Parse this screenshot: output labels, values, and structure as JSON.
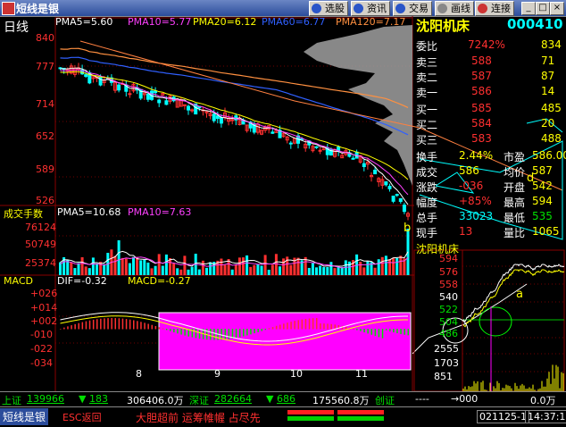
{
  "titlebar": {
    "title": "短线是银",
    "buttons": [
      "选股",
      "资讯",
      "交易",
      "画线",
      "连接"
    ]
  },
  "main_chart": {
    "period_label": "日线",
    "ma_labels": [
      "PMA5=5.60",
      "PMA10=5.77",
      "PMA20=6.12",
      "PMA60=6.77",
      "PMA120=7.17"
    ],
    "ma_colors": [
      "#ffffff",
      "#ff40ff",
      "#ffff00",
      "#3060ff",
      "#ff9040"
    ],
    "y_ticks": [
      "840",
      "777",
      "714",
      "652",
      "589",
      "526"
    ],
    "marker_b": "b",
    "marker_d": "d",
    "marker_a": "a"
  },
  "volume_chart": {
    "title": "成交手数",
    "ma_labels": [
      "PMA5=10.68",
      "PMA10=7.63"
    ],
    "y_ticks": [
      "76124",
      "50749",
      "25374"
    ]
  },
  "macd_chart": {
    "title": "MACD",
    "labels": [
      "DIF=-0.32",
      "MACD=-0.27"
    ],
    "y_ticks": [
      "+026",
      "+014",
      "+002",
      "-010",
      "-022",
      "-034"
    ],
    "x_ticks": [
      "8",
      "9",
      "10",
      "11"
    ]
  },
  "quote_panel": {
    "stock_name": "沈阳机床",
    "stock_code": "000410",
    "weibi_label": "委比",
    "weibi_value": "7242%",
    "weibi_vol": "834",
    "asks": [
      {
        "label": "卖三",
        "price": "588",
        "vol": "71"
      },
      {
        "label": "卖二",
        "price": "587",
        "vol": "87"
      },
      {
        "label": "卖一",
        "price": "586",
        "vol": "14"
      }
    ],
    "bids": [
      {
        "label": "买一",
        "price": "585",
        "vol": "485"
      },
      {
        "label": "买二",
        "price": "584",
        "vol": "20"
      },
      {
        "label": "买三",
        "price": "583",
        "vol": "488"
      }
    ],
    "stats": [
      {
        "l1": "换手",
        "v1": "2.44%",
        "l2": "市盈",
        "v2": "586.00"
      },
      {
        "l1": "成交",
        "v1": "586",
        "l2": "均价",
        "v2": "587"
      },
      {
        "l1": "涨跌",
        "v1": "-036",
        "l2": "开盘",
        "v2": "542"
      },
      {
        "l1": "幅度",
        "v1": "+85%",
        "l2": "最高",
        "v2": "594"
      },
      {
        "l1": "总手",
        "v1": "33023",
        "l2": "最低",
        "v2": "535"
      },
      {
        "l1": "现手",
        "v1": "13",
        "l2": "量比",
        "v2": "1065"
      }
    ]
  },
  "intraday": {
    "title": "沈阳机床",
    "y_ticks": [
      "594",
      "576",
      "558",
      "540",
      "522",
      "504",
      "486"
    ],
    "vol_ticks": [
      "2555",
      "1703",
      "851"
    ]
  },
  "status1": {
    "sh_label": "上证",
    "sh_value": "139966",
    "sh_change": "183",
    "sh_amount": "306406.0万",
    "sz_label": "深证",
    "sz_value": "282664",
    "sz_change": "686",
    "sz_amount": "175560.8万",
    "cy_label": "创证",
    "cy_dashes": "----",
    "cy_arrow": "→000",
    "cy_amount": "0.0万"
  },
  "status2": {
    "app": "短线是银",
    "esc": "ESC返回",
    "ticker": "大胆超前 运筹帷幄 占尽先",
    "date": "021125-1",
    "time": "14:37:17"
  }
}
